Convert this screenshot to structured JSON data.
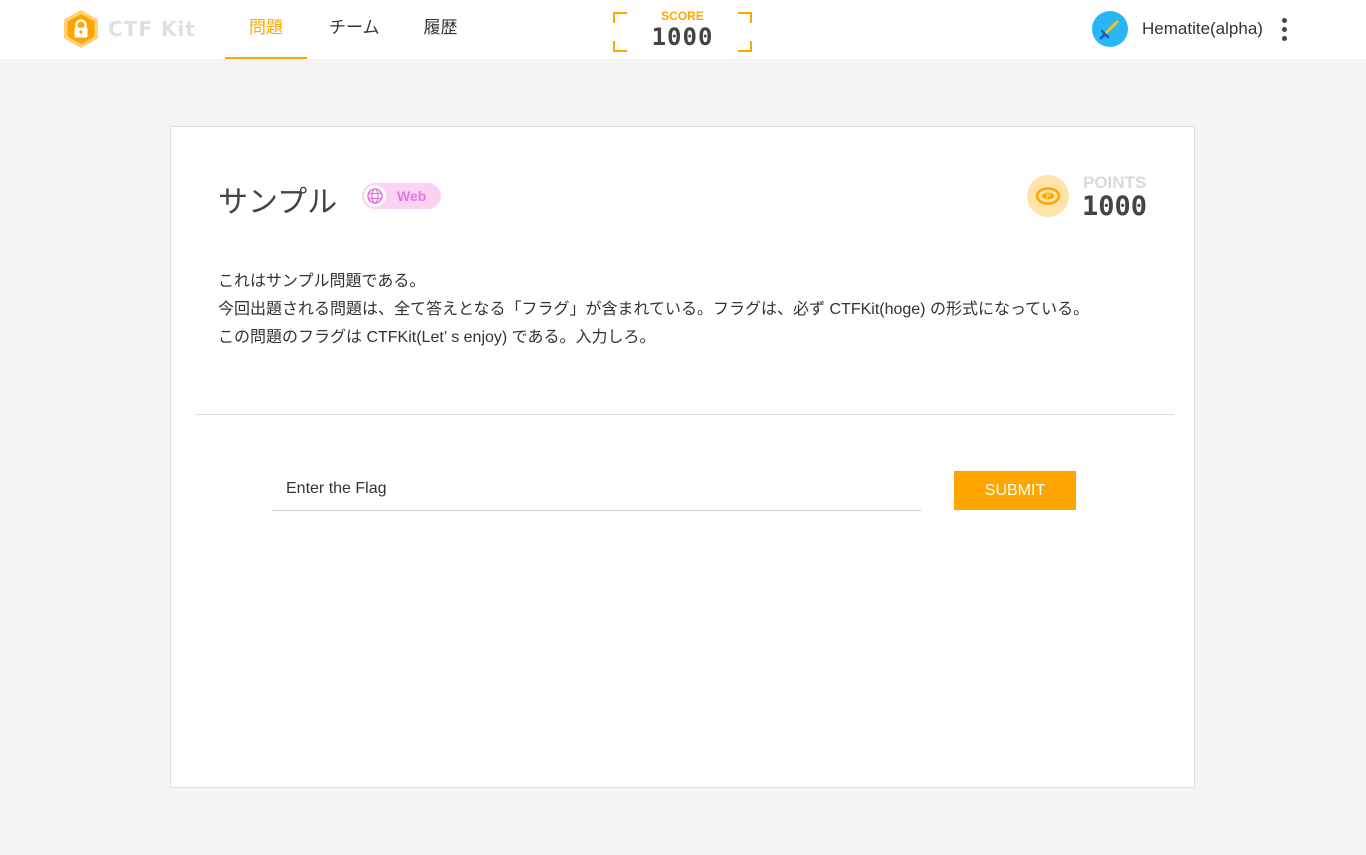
{
  "header": {
    "logo_text": "CTF Kit",
    "nav": [
      {
        "label": "問題",
        "active": true
      },
      {
        "label": "チーム",
        "active": false
      },
      {
        "label": "履歴",
        "active": false
      }
    ],
    "score": {
      "label": "SCORE",
      "value": "1000"
    },
    "user": {
      "name": "Hematite(alpha)",
      "avatar_icon": "sword-icon"
    },
    "menu_icon": "more-vert-icon"
  },
  "problem": {
    "title": "サンプル",
    "category": {
      "label": "Web",
      "icon": "globe-icon"
    },
    "points": {
      "label": "POINTS",
      "value": "1000",
      "icon": "coin-icon"
    },
    "description": [
      "これはサンプル問題である。",
      "今回出題される問題は、全て答えとなる「フラグ」が含まれている。フラグは、必ず CTFKit(hoge) の形式になっている。",
      "この問題のフラグは CTFKit(Let’ s enjoy) である。入力しろ。"
    ],
    "flag_input": {
      "placeholder": "Enter the Flag",
      "value": ""
    },
    "submit_label": "SUBMIT"
  },
  "colors": {
    "accent": "#ffa500",
    "avatar_bg": "#29b6f6",
    "tag_bg": "#fbd2f2",
    "tag_text": "#e07ae0"
  }
}
